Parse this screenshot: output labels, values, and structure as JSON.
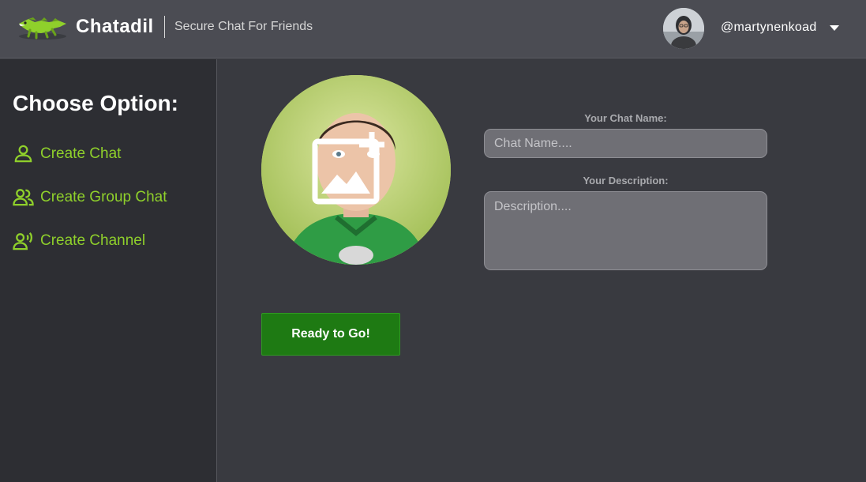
{
  "header": {
    "logo_icon": "crocodile-logo-icon",
    "brand": "Chatadil",
    "tagline": "Secure Chat For Friends",
    "username": "@martynenkoad",
    "avatar_icon": "user-avatar",
    "dropdown_icon": "caret-down-icon"
  },
  "sidebar": {
    "title": "Choose Option:",
    "items": [
      {
        "label": "Create Chat",
        "icon": "person-icon"
      },
      {
        "label": "Create Group Chat",
        "icon": "group-icon"
      },
      {
        "label": "Create Channel",
        "icon": "broadcast-person-icon"
      }
    ]
  },
  "form": {
    "photo_icon": "add-image-icon",
    "chat_name_label": "Your Chat Name:",
    "chat_name_placeholder": "Chat Name....",
    "chat_name_value": "",
    "description_label": "Your Description:",
    "description_placeholder": "Description....",
    "description_value": "",
    "submit_label": "Ready to Go!"
  },
  "colors": {
    "accent_green": "#8fd02b",
    "button_green": "#1e7a13",
    "header_bg": "#4b4c53",
    "sidebar_bg": "#2d2e33",
    "main_bg": "#393a40"
  }
}
